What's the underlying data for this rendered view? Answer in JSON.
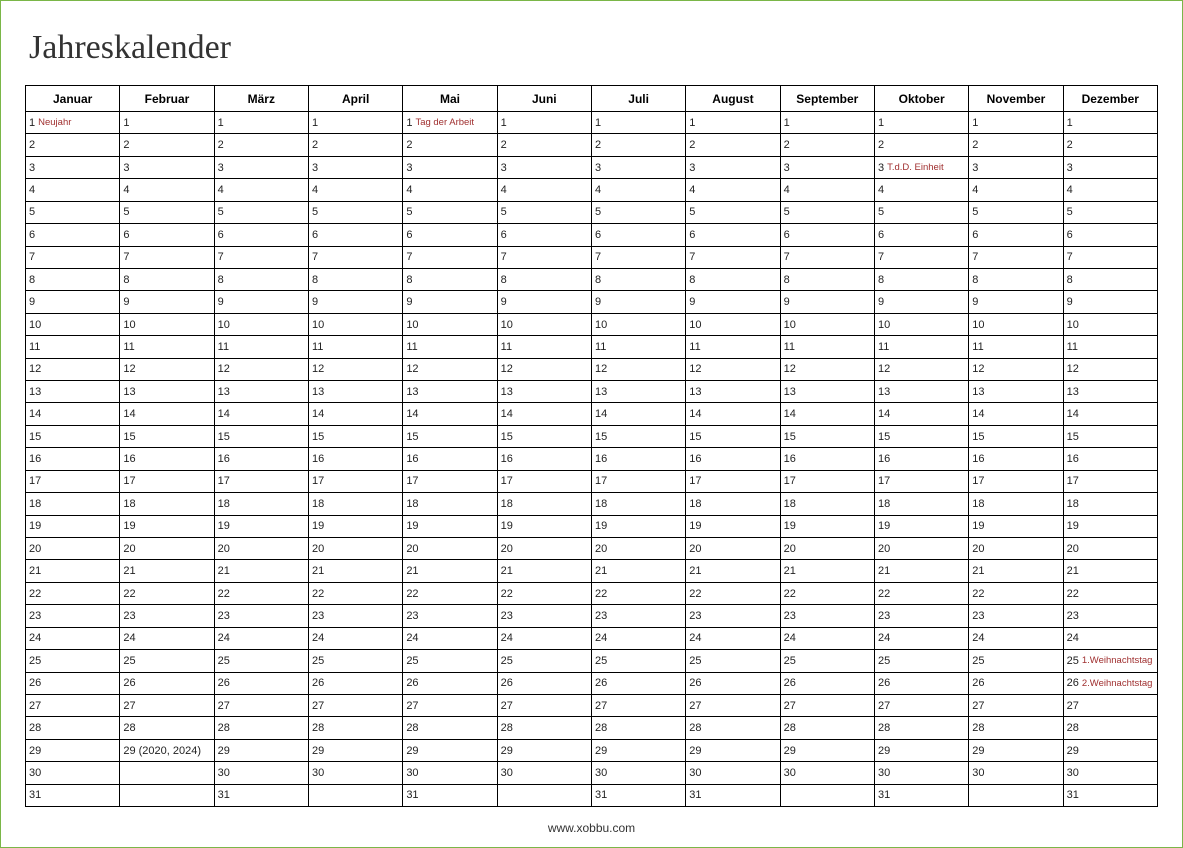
{
  "title": "Jahreskalender",
  "footer": "www.xobbu.com",
  "months": [
    {
      "name": "Januar",
      "days": 31,
      "notes": {
        "1": "Neujahr"
      },
      "extra": {}
    },
    {
      "name": "Februar",
      "days": 28,
      "notes": {},
      "extra": {
        "29": "29 (2020, 2024)"
      }
    },
    {
      "name": "März",
      "days": 31,
      "notes": {},
      "extra": {}
    },
    {
      "name": "April",
      "days": 30,
      "notes": {},
      "extra": {}
    },
    {
      "name": "Mai",
      "days": 31,
      "notes": {
        "1": "Tag der Arbeit"
      },
      "extra": {}
    },
    {
      "name": "Juni",
      "days": 30,
      "notes": {},
      "extra": {}
    },
    {
      "name": "Juli",
      "days": 31,
      "notes": {},
      "extra": {}
    },
    {
      "name": "August",
      "days": 31,
      "notes": {},
      "extra": {}
    },
    {
      "name": "September",
      "days": 30,
      "notes": {},
      "extra": {}
    },
    {
      "name": "Oktober",
      "days": 31,
      "notes": {
        "3": "T.d.D. Einheit"
      },
      "extra": {}
    },
    {
      "name": "November",
      "days": 30,
      "notes": {},
      "extra": {}
    },
    {
      "name": "Dezember",
      "days": 31,
      "notes": {
        "25": "1.Weihnachtstag",
        "26": "2.Weihnachtstag"
      },
      "extra": {}
    }
  ],
  "max_rows": 31
}
